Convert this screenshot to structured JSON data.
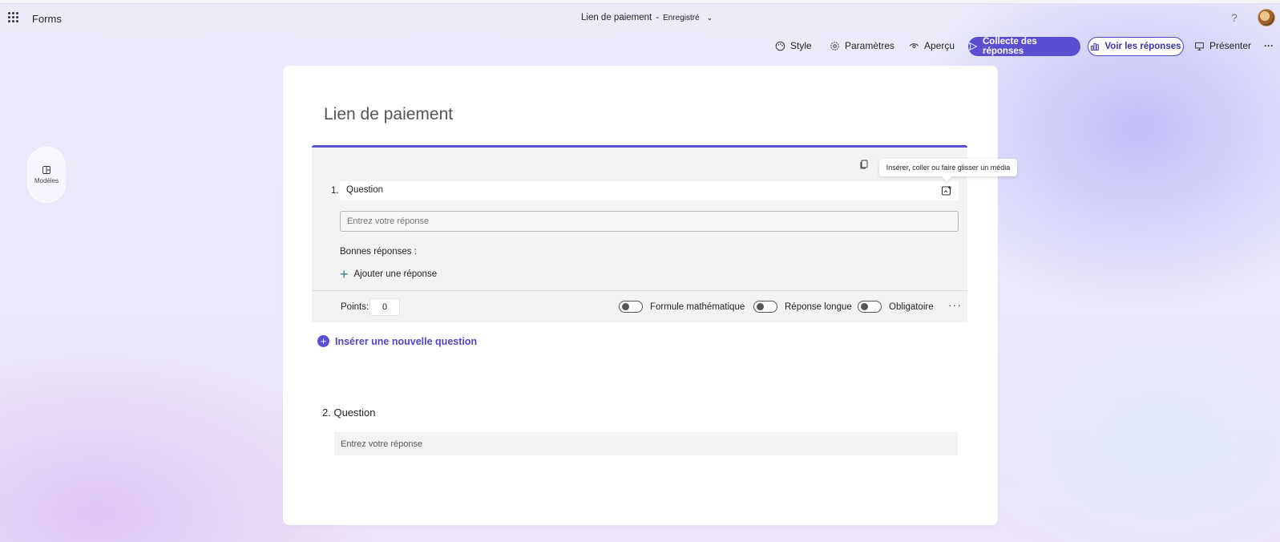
{
  "app": {
    "name": "Forms"
  },
  "document": {
    "title": "Lien de paiement",
    "separator": "-",
    "status": "Enregistré"
  },
  "header": {
    "help": "?"
  },
  "toolbar": {
    "style": "Style",
    "settings": "Paramètres",
    "preview": "Aperçu",
    "collect": "Collecte des réponses",
    "view_responses": "Voir les réponses",
    "present": "Présenter",
    "more": "···"
  },
  "sidebar": {
    "templates_label": "Modèles"
  },
  "form": {
    "title": "Lien de paiement",
    "accent_color": "#5b4fd1",
    "questions": [
      {
        "number": "1.",
        "text": "Question",
        "answer_placeholder": "Entrez votre réponse",
        "correct_answers_label": "Bonnes réponses :",
        "add_answer": "Ajouter une réponse",
        "points_label": "Points:",
        "points_value": "0",
        "toggles": [
          {
            "label": "Formule mathématique",
            "on": false
          },
          {
            "label": "Réponse longue",
            "on": false
          },
          {
            "label": "Obligatoire",
            "on": false
          }
        ],
        "more": "···"
      },
      {
        "number": "2.",
        "text": "Question",
        "answer_placeholder": "Entrez votre réponse"
      }
    ],
    "insert_question": "Insérer une nouvelle question"
  },
  "tooltip": {
    "text": "Insérer, coller ou faire glisser un média"
  }
}
